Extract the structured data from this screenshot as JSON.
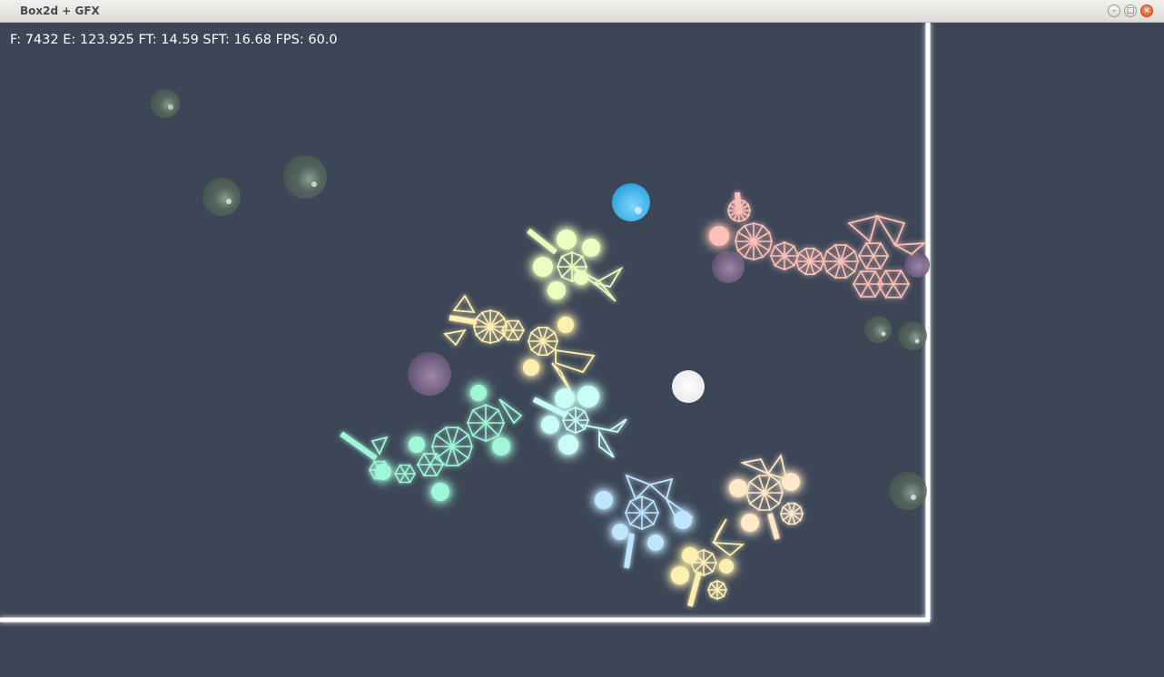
{
  "window": {
    "title": "Box2d + GFX",
    "controls": {
      "minimize": "–",
      "maximize": "□",
      "close": "×"
    }
  },
  "hud": {
    "text": "F: 7432 E: 123.925 FT: 14.59 SFT: 16.68 FPS: 60.0"
  },
  "colors": {
    "background": "#3c4656",
    "walls": "#ffffff",
    "creatures": [
      "#eaffc0",
      "#fff0b0",
      "#a0f7d8",
      "#c8fff6",
      "#bfe6ff",
      "#ffe8c8",
      "#ffc0b8"
    ]
  }
}
